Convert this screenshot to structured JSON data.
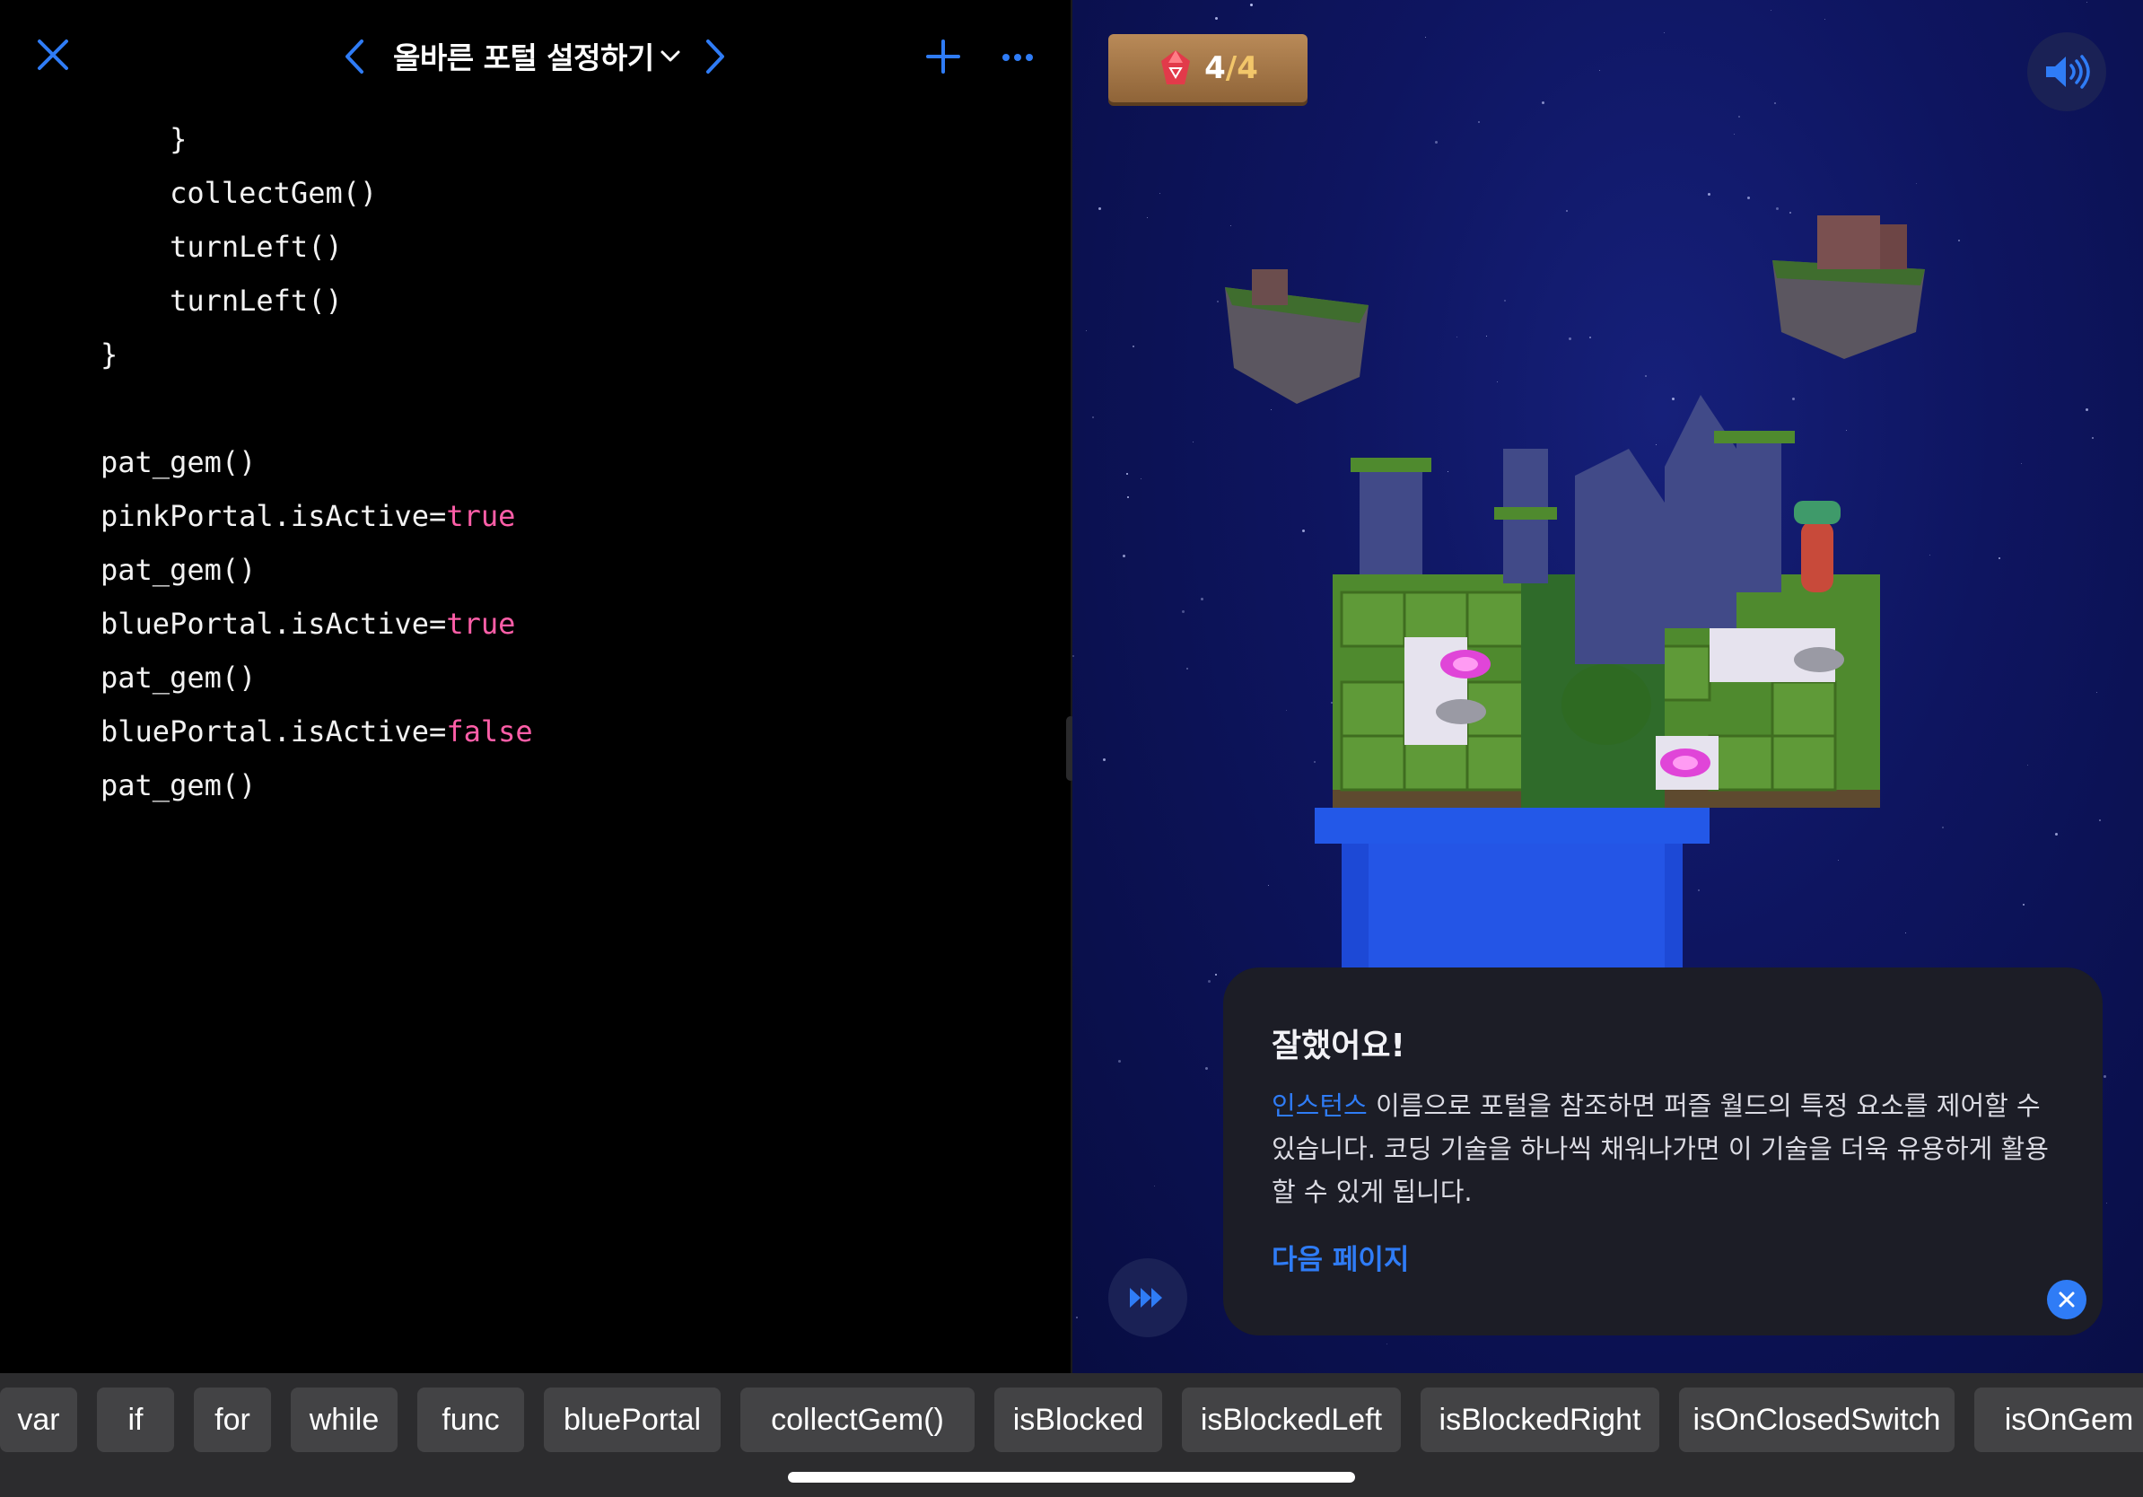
{
  "editor": {
    "title": "올바른 포털 설정하기",
    "code_lines": [
      {
        "indent": "    ",
        "text": "}"
      },
      {
        "indent": "    ",
        "text": "collectGem()"
      },
      {
        "indent": "    ",
        "text": "turnLeft()"
      },
      {
        "indent": "    ",
        "text": "turnLeft()"
      },
      {
        "indent": "",
        "text": "}"
      },
      {
        "indent": "",
        "text": ""
      },
      {
        "indent": "",
        "text": "pat_gem()"
      },
      {
        "indent": "",
        "text": "pinkPortal.isActive=",
        "kw": "true"
      },
      {
        "indent": "",
        "text": "pat_gem()"
      },
      {
        "indent": "",
        "text": "bluePortal.isActive=",
        "kw": "true"
      },
      {
        "indent": "",
        "text": "pat_gem()"
      },
      {
        "indent": "",
        "text": "bluePortal.isActive=",
        "kw": "false"
      },
      {
        "indent": "",
        "text": "pat_gem()"
      }
    ]
  },
  "game": {
    "gems_collected": "4",
    "gems_separator": "/",
    "gems_total": "4"
  },
  "card": {
    "title": "잘했어요!",
    "body_link": "인스턴스",
    "body_text": " 이름으로 포털을 참조하면 퍼즐 월드의 특정 요소를 제어할 수 있습니다. 코딩 기술을 하나씩 채워나가면 이 기술을 더욱 유용하게 활용할 수 있게 됩니다.",
    "next_label": "다음 페이지"
  },
  "shortcuts": [
    "var",
    "if",
    "for",
    "while",
    "func",
    "bluePortal",
    "collectGem()",
    "isBlocked",
    "isBlockedLeft",
    "isBlockedRight",
    "isOnClosedSwitch",
    "isOnGem"
  ],
  "colors": {
    "accent": "#2f7cf6",
    "keyword": "#ff5ea8",
    "editor_bg": "#000000",
    "shortcut_bar": "#2c2c2e",
    "sky": "#0e1560"
  }
}
